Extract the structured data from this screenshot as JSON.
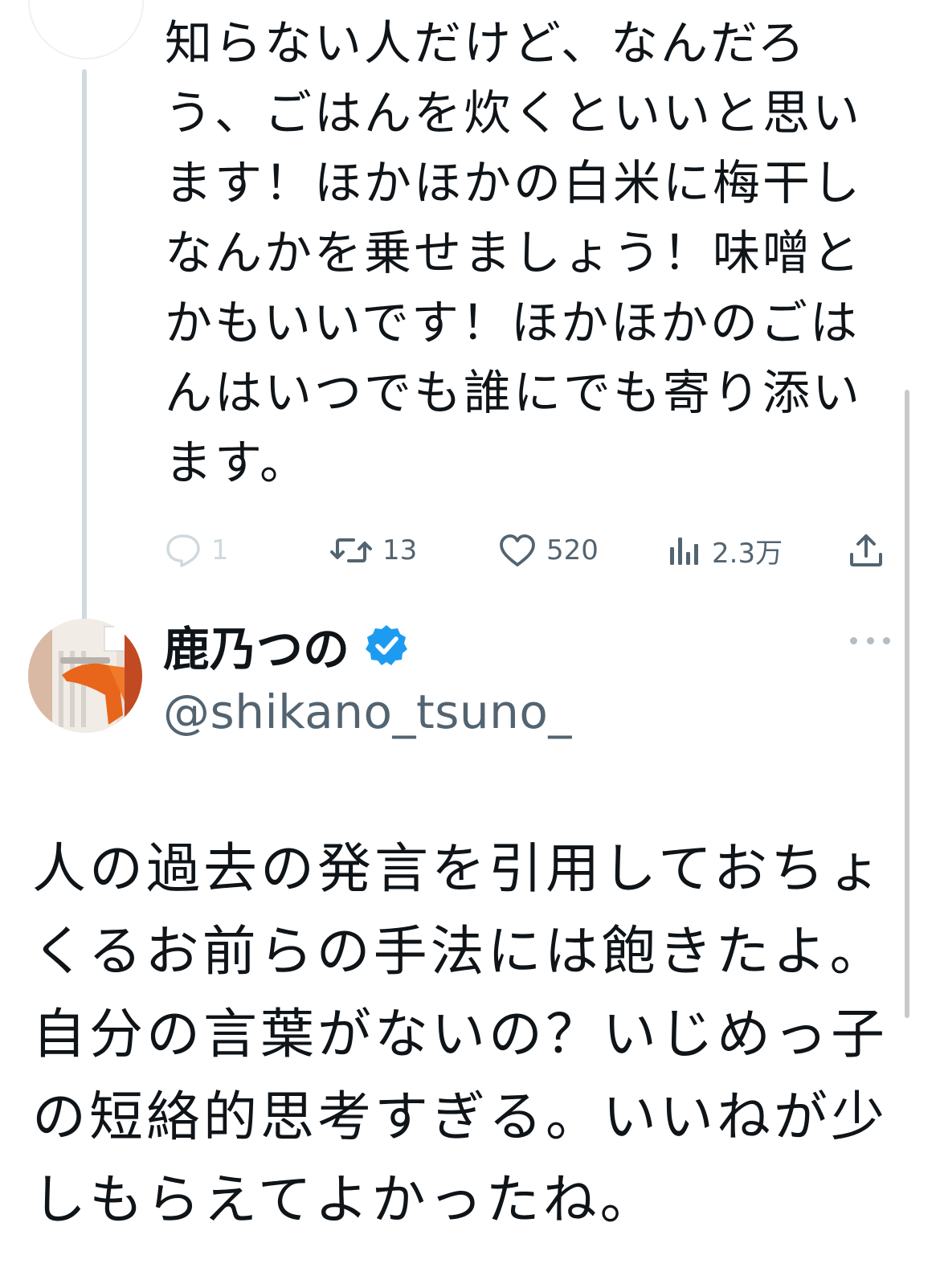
{
  "parent_tweet": {
    "text_lines": [
      "知らない人だけど、なんだろ",
      "う、ごはんを炊くといいと思い",
      "ます！ほかほかの白米に梅干し",
      "なんかを乗せましょう！味噌と",
      "かもいいです！ほかほかのごは",
      "んはいつでも誰にでも寄り添い",
      "ます。"
    ],
    "actions": {
      "reply_count": "1",
      "retweet_count": "13",
      "like_count": "520",
      "view_count": "2.3万"
    }
  },
  "reply_tweet": {
    "display_name": "鹿乃つの",
    "handle": "@shikano_tsuno_",
    "text_lines": [
      "人の過去の発言を引用しておちょ",
      "くるお前らの手法には飽きたよ。",
      "自分の言葉がないの？いじめっ子",
      "の短絡的思考すぎる。いいねが少",
      "しもらえてよかったね。"
    ]
  },
  "colors": {
    "text_primary": "#0f1419",
    "text_secondary": "#536471",
    "verified_blue": "#1d9bf0",
    "thread_line": "#cfd9de"
  },
  "icons": {
    "reply": "reply-icon",
    "retweet": "retweet-icon",
    "like": "heart-icon",
    "views": "views-chart-icon",
    "share": "share-icon",
    "verified": "verified-badge-icon",
    "more": "more-dots-icon"
  }
}
